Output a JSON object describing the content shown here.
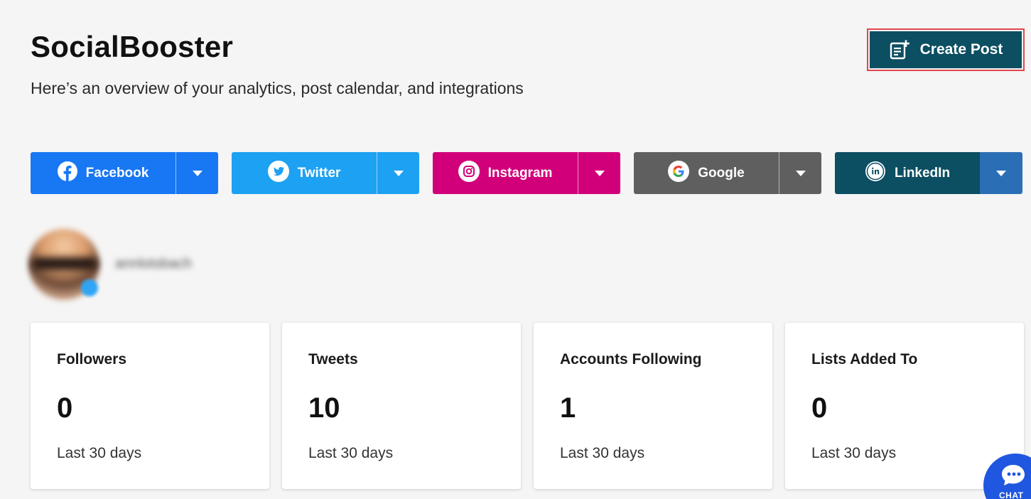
{
  "header": {
    "title": "SocialBooster",
    "subtitle": "Here’s an overview of your analytics, post calendar, and integrations",
    "create_post_label": "Create Post"
  },
  "social_buttons": [
    {
      "label": "Facebook",
      "icon": "facebook-icon",
      "color": "#1877f2"
    },
    {
      "label": "Twitter",
      "icon": "twitter-icon",
      "color": "#1da1f2"
    },
    {
      "label": "Instagram",
      "icon": "instagram-icon",
      "color": "#d1007a"
    },
    {
      "label": "Google",
      "icon": "google-icon",
      "color": "#5f5f5f"
    },
    {
      "label": "LinkedIn",
      "icon": "linkedin-icon",
      "color": "#0c4e62"
    }
  ],
  "profile": {
    "username": "annlotsbach"
  },
  "stats": [
    {
      "label": "Followers",
      "value": "0",
      "period": "Last 30 days"
    },
    {
      "label": "Tweets",
      "value": "10",
      "period": "Last 30 days"
    },
    {
      "label": "Accounts Following",
      "value": "1",
      "period": "Last 30 days"
    },
    {
      "label": "Lists Added To",
      "value": "0",
      "period": "Last 30 days"
    }
  ],
  "chat": {
    "label": "CHAT"
  },
  "colors": {
    "accent": "#0c4e62",
    "background": "#f5f5f5",
    "chat": "#1f57e0",
    "highlight_border": "#e0474c"
  }
}
